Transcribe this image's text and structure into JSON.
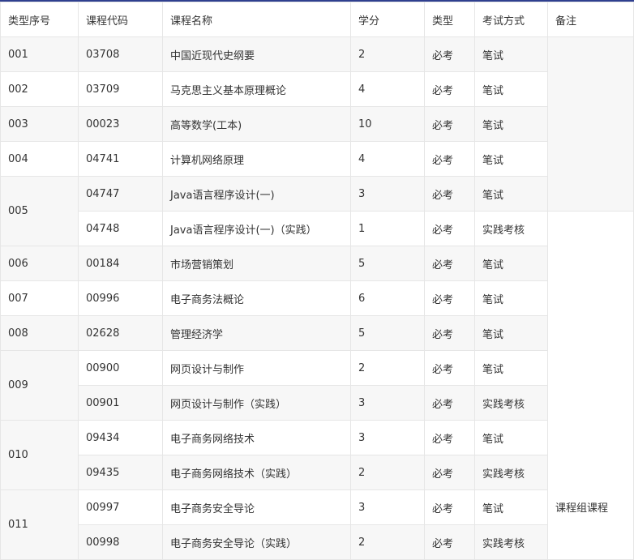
{
  "headers": [
    "类型序号",
    "课程代码",
    "课程名称",
    "学分",
    "类型",
    "考试方式",
    "备注"
  ],
  "groups": [
    {
      "seq": "001",
      "courses": [
        {
          "code": "03708",
          "name": "中国近现代史纲要",
          "credit": "2",
          "type": "必考",
          "exam": "笔试"
        }
      ]
    },
    {
      "seq": "002",
      "courses": [
        {
          "code": "03709",
          "name": "马克思主义基本原理概论",
          "credit": "4",
          "type": "必考",
          "exam": "笔试"
        }
      ]
    },
    {
      "seq": "003",
      "courses": [
        {
          "code": "00023",
          "name": "高等数学(工本)",
          "credit": "10",
          "type": "必考",
          "exam": "笔试"
        }
      ]
    },
    {
      "seq": "004",
      "courses": [
        {
          "code": "04741",
          "name": "计算机网络原理",
          "credit": "4",
          "type": "必考",
          "exam": "笔试"
        }
      ]
    },
    {
      "seq": "005",
      "courses": [
        {
          "code": "04747",
          "name": "Java语言程序设计(一)",
          "credit": "3",
          "type": "必考",
          "exam": "笔试"
        },
        {
          "code": "04748",
          "name": "Java语言程序设计(一)（实践）",
          "credit": "1",
          "type": "必考",
          "exam": "实践考核"
        }
      ]
    },
    {
      "seq": "006",
      "courses": [
        {
          "code": "00184",
          "name": "市场营销策划",
          "credit": "5",
          "type": "必考",
          "exam": "笔试"
        }
      ]
    },
    {
      "seq": "007",
      "courses": [
        {
          "code": "00996",
          "name": "电子商务法概论",
          "credit": "6",
          "type": "必考",
          "exam": "笔试"
        }
      ]
    },
    {
      "seq": "008",
      "courses": [
        {
          "code": "02628",
          "name": "管理经济学",
          "credit": "5",
          "type": "必考",
          "exam": "笔试"
        }
      ]
    },
    {
      "seq": "009",
      "courses": [
        {
          "code": "00900",
          "name": "网页设计与制作",
          "credit": "2",
          "type": "必考",
          "exam": "笔试"
        },
        {
          "code": "00901",
          "name": "网页设计与制作（实践）",
          "credit": "3",
          "type": "必考",
          "exam": "实践考核"
        }
      ]
    },
    {
      "seq": "010",
      "courses": [
        {
          "code": "09434",
          "name": "电子商务网络技术",
          "credit": "3",
          "type": "必考",
          "exam": "笔试"
        },
        {
          "code": "09435",
          "name": "电子商务网络技术（实践）",
          "credit": "2",
          "type": "必考",
          "exam": "实践考核"
        }
      ]
    },
    {
      "seq": "011",
      "courses": [
        {
          "code": "00997",
          "name": "电子商务安全导论",
          "credit": "3",
          "type": "必考",
          "exam": "笔试"
        },
        {
          "code": "00998",
          "name": "电子商务安全导论（实践）",
          "credit": "2",
          "type": "必考",
          "exam": "实践考核"
        }
      ]
    }
  ],
  "remarks": [
    "",
    "课程组课程"
  ]
}
